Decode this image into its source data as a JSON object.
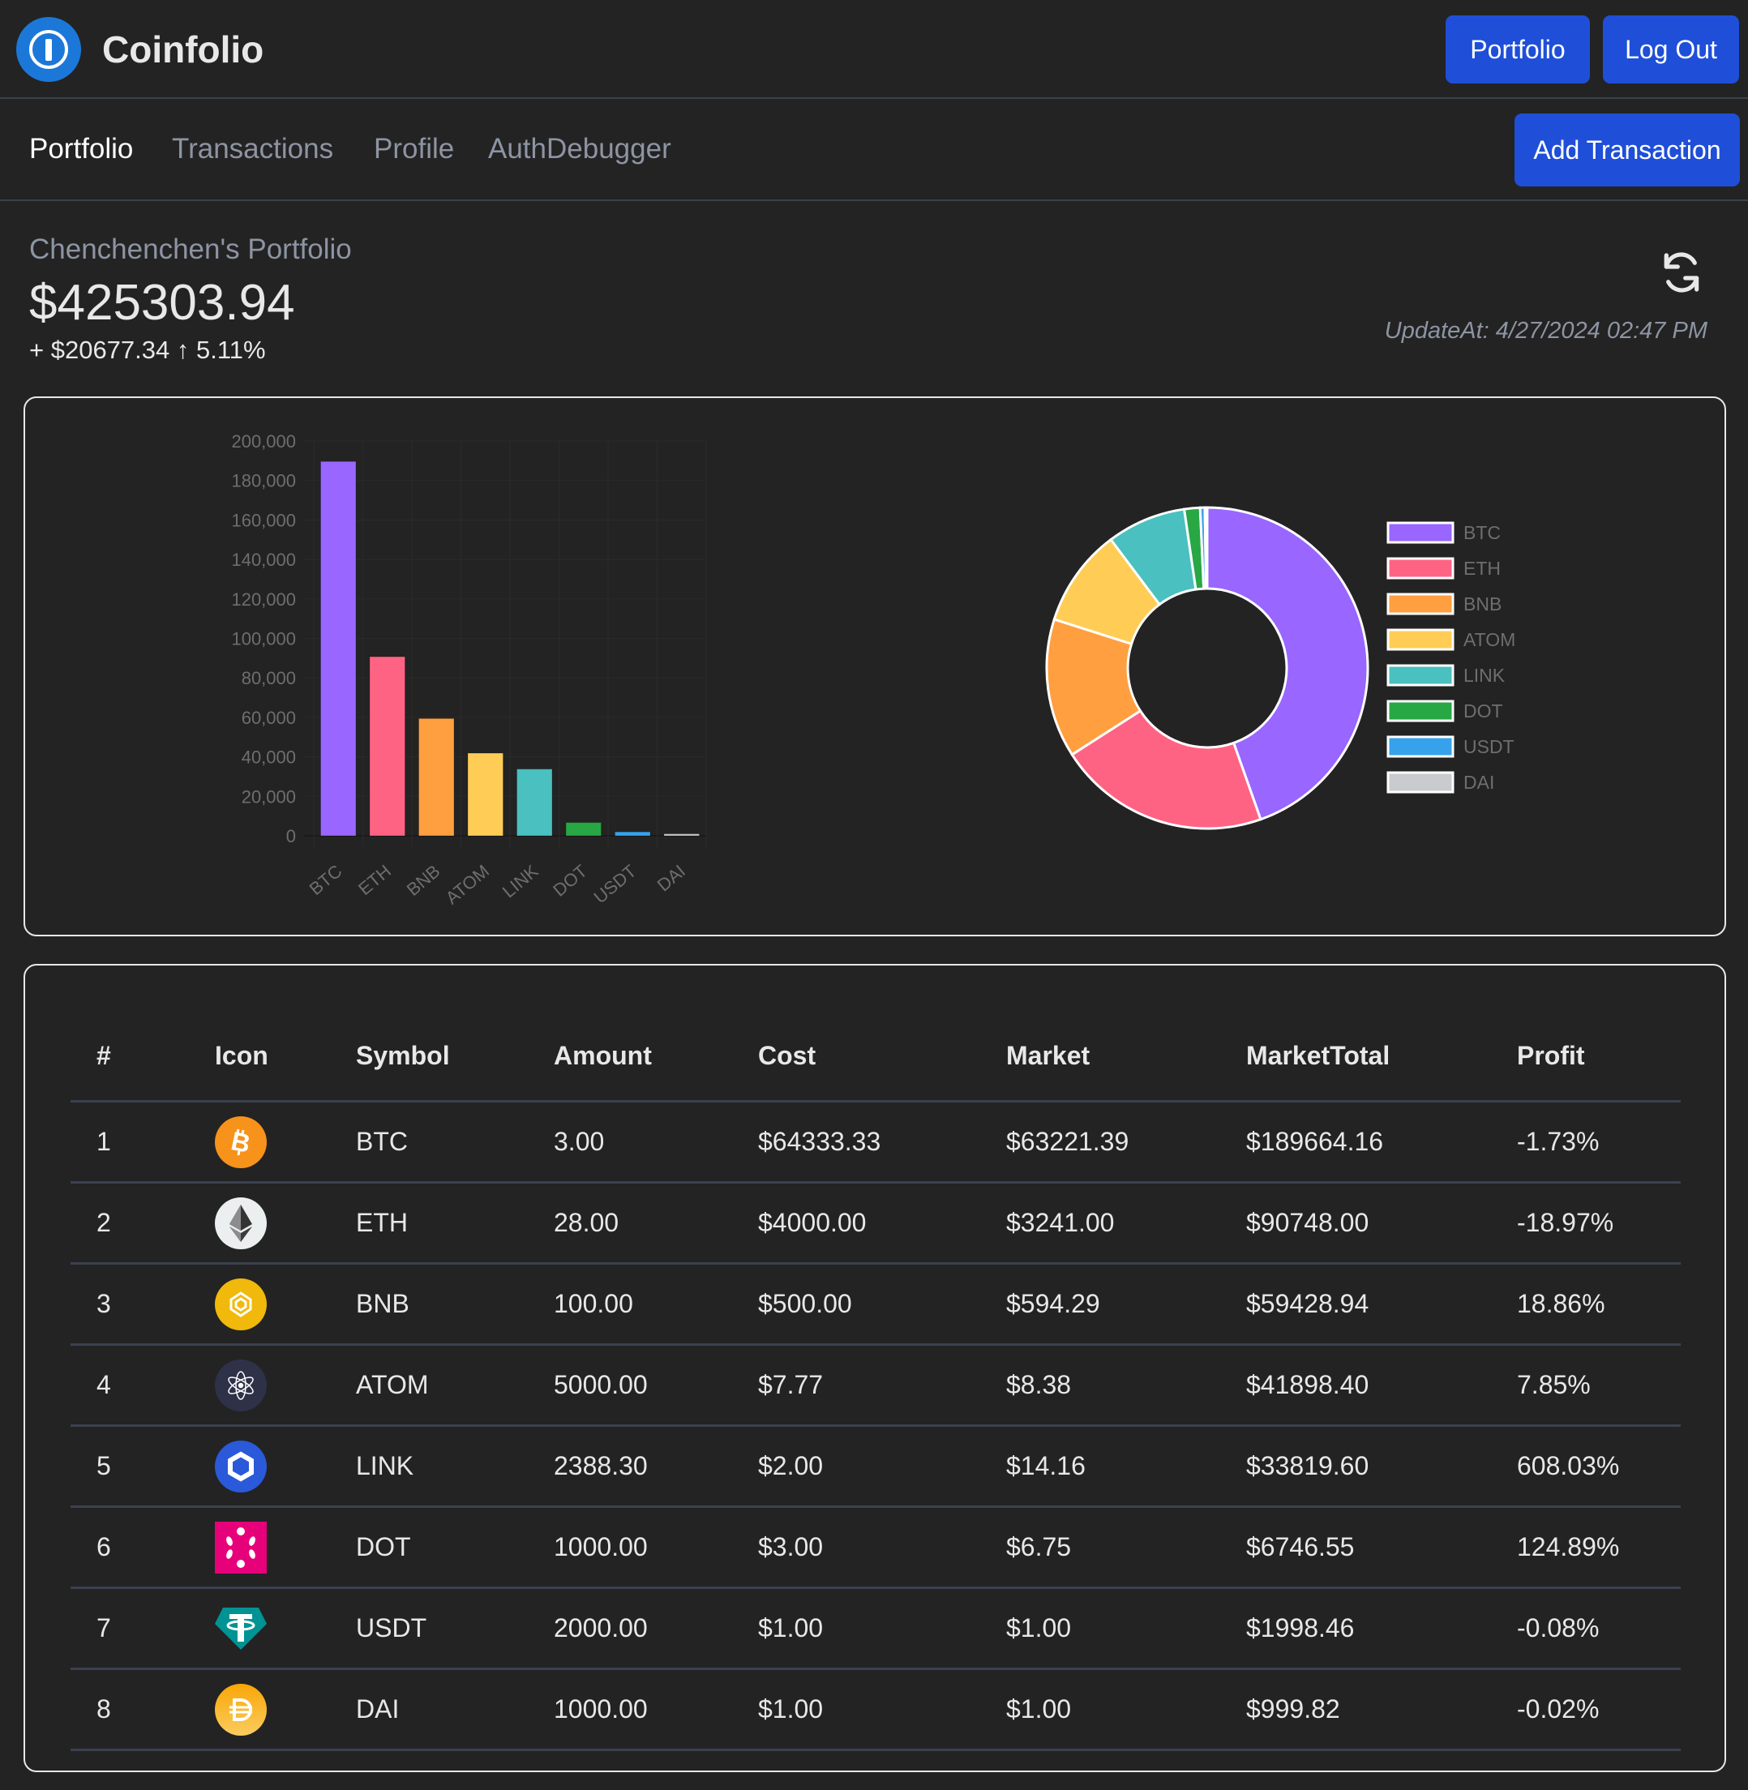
{
  "app": {
    "title": "Coinfolio"
  },
  "header": {
    "portfolio_label": "Portfolio",
    "logout_label": "Log Out"
  },
  "nav": {
    "items": [
      {
        "label": "Portfolio",
        "active": true
      },
      {
        "label": "Transactions",
        "active": false
      },
      {
        "label": "Profile",
        "active": false
      },
      {
        "label": "AuthDebugger",
        "active": false
      }
    ],
    "add_transaction_label": "Add Transaction"
  },
  "summary": {
    "owner": "Chenchenchen's Portfolio",
    "total_value": "$425303.94",
    "change": "+ $20677.34 ↑ 5.11%",
    "updated_at": "UpdateAt: 4/27/2024 02:47 PM",
    "refresh_icon": "refresh-icon"
  },
  "colors": {
    "BTC": "#9966ff",
    "ETH": "#ff6384",
    "BNB": "#ff9f40",
    "ATOM": "#ffcd56",
    "LINK": "#4bc0c0",
    "DOT": "#28a745",
    "USDT": "#36a2eb",
    "DAI": "#c9cbcf",
    "button": "#1f4fd8"
  },
  "chart_data": [
    {
      "type": "bar",
      "categories": [
        "BTC",
        "ETH",
        "BNB",
        "ATOM",
        "LINK",
        "DOT",
        "USDT",
        "DAI"
      ],
      "values": [
        189664.16,
        90748.0,
        59428.94,
        41898.4,
        33819.6,
        6746.55,
        1998.46,
        999.82
      ],
      "yticks": [
        "0",
        "20,000",
        "40,000",
        "60,000",
        "80,000",
        "100,000",
        "120,000",
        "140,000",
        "160,000",
        "180,000",
        "200,000"
      ],
      "ylim": [
        0,
        200000
      ],
      "grid": true,
      "title": "",
      "xlabel": "",
      "ylabel": ""
    },
    {
      "type": "pie",
      "variant": "doughnut",
      "categories": [
        "BTC",
        "ETH",
        "BNB",
        "ATOM",
        "LINK",
        "DOT",
        "USDT",
        "DAI"
      ],
      "values": [
        189664.16,
        90748.0,
        59428.94,
        41898.4,
        33819.6,
        6746.55,
        1998.46,
        999.82
      ],
      "legend": "right"
    }
  ],
  "table": {
    "columns": [
      "#",
      "Icon",
      "Symbol",
      "Amount",
      "Cost",
      "Market",
      "MarketTotal",
      "Profit"
    ],
    "rows": [
      {
        "num": "1",
        "icon": "bitcoin-icon",
        "symbol": "BTC",
        "amount": "3.00",
        "cost": "$64333.33",
        "market": "$63221.39",
        "market_total": "$189664.16",
        "profit": "-1.73%"
      },
      {
        "num": "2",
        "icon": "ethereum-icon",
        "symbol": "ETH",
        "amount": "28.00",
        "cost": "$4000.00",
        "market": "$3241.00",
        "market_total": "$90748.00",
        "profit": "-18.97%"
      },
      {
        "num": "3",
        "icon": "bnb-icon",
        "symbol": "BNB",
        "amount": "100.00",
        "cost": "$500.00",
        "market": "$594.29",
        "market_total": "$59428.94",
        "profit": "18.86%"
      },
      {
        "num": "4",
        "icon": "cosmos-atom-icon",
        "symbol": "ATOM",
        "amount": "5000.00",
        "cost": "$7.77",
        "market": "$8.38",
        "market_total": "$41898.40",
        "profit": "7.85%"
      },
      {
        "num": "5",
        "icon": "chainlink-icon",
        "symbol": "LINK",
        "amount": "2388.30",
        "cost": "$2.00",
        "market": "$14.16",
        "market_total": "$33819.60",
        "profit": "608.03%"
      },
      {
        "num": "6",
        "icon": "polkadot-icon",
        "symbol": "DOT",
        "amount": "1000.00",
        "cost": "$3.00",
        "market": "$6.75",
        "market_total": "$6746.55",
        "profit": "124.89%"
      },
      {
        "num": "7",
        "icon": "tether-icon",
        "symbol": "USDT",
        "amount": "2000.00",
        "cost": "$1.00",
        "market": "$1.00",
        "market_total": "$1998.46",
        "profit": "-0.08%"
      },
      {
        "num": "8",
        "icon": "dai-icon",
        "symbol": "DAI",
        "amount": "1000.00",
        "cost": "$1.00",
        "market": "$1.00",
        "market_total": "$999.82",
        "profit": "-0.02%"
      }
    ]
  }
}
